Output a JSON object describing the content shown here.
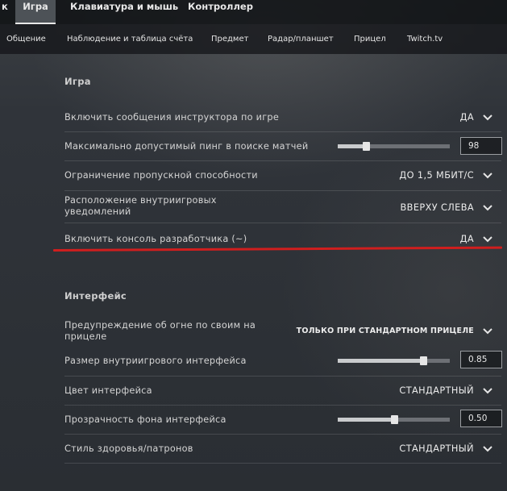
{
  "top_tabs": [
    {
      "label": "к",
      "active": false
    },
    {
      "label": "Игра",
      "active": true
    },
    {
      "label": "Клавиатура и мышь",
      "active": false
    },
    {
      "label": "Контроллер",
      "active": false
    }
  ],
  "sub_tabs": [
    "Общение",
    "Наблюдение и таблица счёта",
    "Предмет",
    "Радар/планшет",
    "Прицел",
    "Twitch.tv"
  ],
  "sections": {
    "game": {
      "title": "Игра",
      "rows": [
        {
          "label": "Включить сообщения инструктора по игре",
          "value": "ДА"
        },
        {
          "label": "Максимально допустимый пинг в поиске матчей",
          "slider_fraction": 0.25,
          "number": "98"
        },
        {
          "label": "Ограничение пропускной способности",
          "value": "ДО 1,5 МБИТ/С"
        },
        {
          "label": "Расположение внутриигровых уведомлений",
          "value": "ВВЕРХУ СЛЕВА"
        },
        {
          "label": "Включить консоль разработчика (~)",
          "value": "ДА"
        }
      ]
    },
    "interface": {
      "title": "Интерфейс",
      "rows": [
        {
          "label": "Предупреждение об огне по своим на прицеле",
          "value": "ТОЛЬКО ПРИ СТАНДАРТНОМ ПРИЦЕЛЕ"
        },
        {
          "label": "Размер внутриигрового интерфейса",
          "slider_fraction": 0.76,
          "number": "0.85"
        },
        {
          "label": "Цвет интерфейса",
          "value": "СТАНДАРТНЫЙ"
        },
        {
          "label": "Прозрачность фона интерфейса",
          "slider_fraction": 0.5,
          "number": "0.50"
        },
        {
          "label": "Стиль здоровья/патронов",
          "value": "СТАНДАРТНЫЙ"
        }
      ]
    }
  },
  "colors": {
    "highlight_line": "#d01e1e",
    "active_tab_bg": "#4d5257"
  },
  "icons": {
    "dropdown": "chevron-down-icon"
  }
}
